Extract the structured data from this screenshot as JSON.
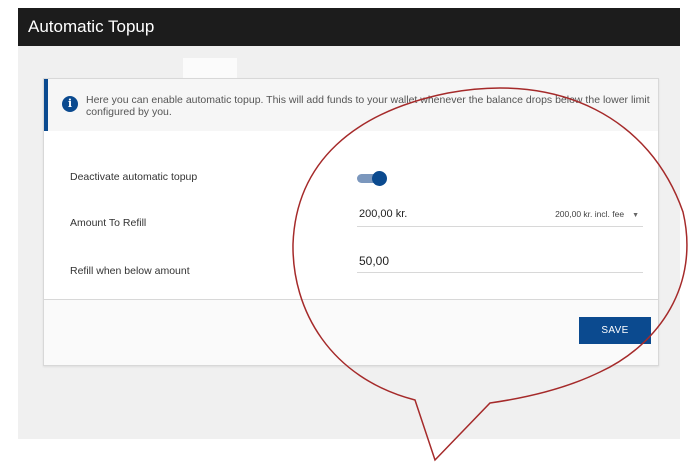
{
  "window": {
    "title": "Automatic Topup"
  },
  "info": {
    "text": "Here you can enable automatic topup. This will add funds to your wallet whenever the balance drops below the lower limit configured by you."
  },
  "form": {
    "deactivate_label": "Deactivate automatic topup",
    "toggle_on": true,
    "amount_label": "Amount To Refill",
    "amount_value": "200,00 kr.",
    "amount_select": "200,00 kr. incl. fee",
    "below_label": "Refill when below amount",
    "below_value": "50,00"
  },
  "buttons": {
    "save": "SAVE"
  },
  "colors": {
    "accent": "#0b4a8f",
    "annotation": "#a52a2a"
  },
  "icons": {
    "info": "info-icon",
    "caret": "chevron-down-icon"
  }
}
